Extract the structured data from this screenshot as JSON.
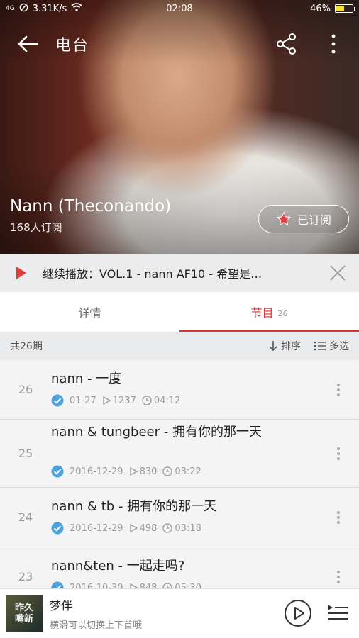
{
  "status_bar": {
    "network": "4G",
    "speed": "3.31K/s",
    "time": "02:08",
    "battery": "46%",
    "battery_level": 0.46
  },
  "header": {
    "back_icon": "arrow-left-icon",
    "title": "电台",
    "share_icon": "share-icon",
    "more_icon": "more-vertical-icon"
  },
  "podcast": {
    "name": "Nann (Theconando)",
    "subscribers": "168人订阅",
    "subscribe_label": "已订阅",
    "subscribe_icon": "star-icon"
  },
  "resume": {
    "text": "继续播放：VOL.1 - nann AF10 - 希望是…",
    "play_icon": "play-triangle-icon",
    "close_icon": "close-icon"
  },
  "tabs": [
    {
      "label": "详情",
      "active": false
    },
    {
      "label": "节目",
      "count": "26",
      "active": true
    }
  ],
  "list_header": {
    "total": "共26期",
    "sort_label": "排序",
    "multi_label": "多选"
  },
  "episodes": [
    {
      "num": "26",
      "title": "nann - 一度",
      "date": "01-27",
      "plays": "1237",
      "duration": "04:12"
    },
    {
      "num": "25",
      "title": "nann & tungbeer - 拥有你的那一天",
      "date": "2016-12-29",
      "plays": "830",
      "duration": "03:22"
    },
    {
      "num": "24",
      "title": "nann & tb - 拥有你的那一天",
      "date": "2016-12-29",
      "plays": "498",
      "duration": "03:18"
    },
    {
      "num": "23",
      "title": "nann&ten - 一起走吗?",
      "date": "2016-10-30",
      "plays": "848",
      "duration": "05:30"
    }
  ],
  "player": {
    "title": "梦伴",
    "subtitle": "横滑可以切换上下首哦",
    "cover_text": "昨久\n嘴新",
    "play_icon": "play-circle-icon",
    "queue_icon": "playlist-icon"
  },
  "colors": {
    "accent": "#dd3333",
    "checkmark": "#4aa3df"
  }
}
